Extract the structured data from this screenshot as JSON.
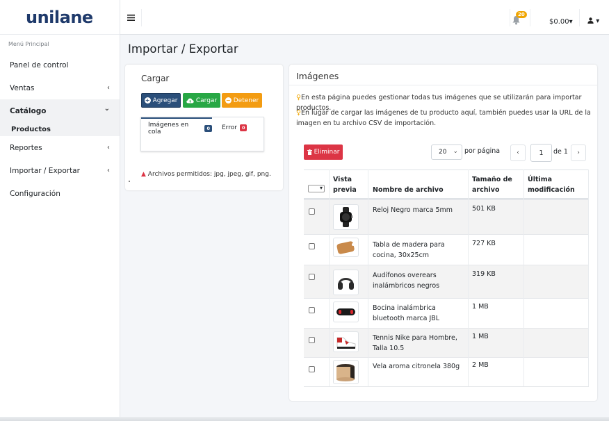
{
  "brand": {
    "name": "unilane"
  },
  "sidebar": {
    "header": "Menú Principal",
    "items": [
      {
        "label": "Panel de control",
        "chevron": ""
      },
      {
        "label": "Ventas",
        "chevron": "‹"
      },
      {
        "label": "Catálogo",
        "chevron": "⌄"
      },
      {
        "label": "Reportes",
        "chevron": "‹"
      },
      {
        "label": "Importar / Exportar",
        "chevron": "‹"
      },
      {
        "label": "Configuración",
        "chevron": ""
      }
    ],
    "sub_items": [
      {
        "label": "Productos"
      }
    ]
  },
  "topbar": {
    "menu_icon": "hamburger-icon",
    "notifications_count": "20",
    "balance": "$0.00",
    "balance_caret": "▾",
    "user_icon": "user-icon",
    "user_caret": "▾"
  },
  "page": {
    "title": "Importar / Exportar"
  },
  "upload": {
    "title": "Cargar",
    "buttons": {
      "add": "Agregar",
      "upload": "Cargar",
      "stop": "Detener"
    },
    "tabs": [
      {
        "label": "Imágenes en cola",
        "count": "0"
      },
      {
        "label": "Error",
        "count": "0"
      }
    ],
    "allowed_text": "Archivos permitidos: jpg, jpeg, gif, png."
  },
  "images": {
    "title": "Imágenes",
    "info_1": "En esta página puedes gestionar todas tus imágenes que se utilizarán para importar productos.",
    "info_2": "En lugar de cargar las imágenes de tu producto aquí, también puedes usar la URL de la imagen en tu archivo CSV de importación.",
    "delete_label": "Eliminar",
    "per_page_value": "20",
    "per_page_label": "por página",
    "page_current": "1",
    "page_of": "de 1",
    "prev": "‹",
    "next": "›",
    "columns": [
      "Vista previa",
      "Nombre de archivo",
      "Tamaño de archivo",
      "Última modificación"
    ],
    "rows": [
      {
        "name": "Reloj Negro marca 5mm",
        "size": "501 KB",
        "modified": "",
        "thumb": "watch"
      },
      {
        "name": "Tabla de madera para cocina, 30x25cm",
        "size": "727 KB",
        "modified": "",
        "thumb": "board"
      },
      {
        "name": "Audífonos overears inalámbricos negros",
        "size": "319 KB",
        "modified": "",
        "thumb": "headphones"
      },
      {
        "name": "Bocina inalámbrica bluetooth marca JBL",
        "size": "1 MB",
        "modified": "",
        "thumb": "speaker"
      },
      {
        "name": "Tennis Nike para Hombre, Talla 10.5",
        "size": "1 MB",
        "modified": "",
        "thumb": "sneaker"
      },
      {
        "name": "Vela aroma citronela 380g",
        "size": "2 MB",
        "modified": "",
        "thumb": "candle"
      }
    ]
  },
  "colors": {
    "primary": "#2b4f7a",
    "success": "#28a745",
    "warning": "#f39c12",
    "danger": "#dc3545"
  }
}
